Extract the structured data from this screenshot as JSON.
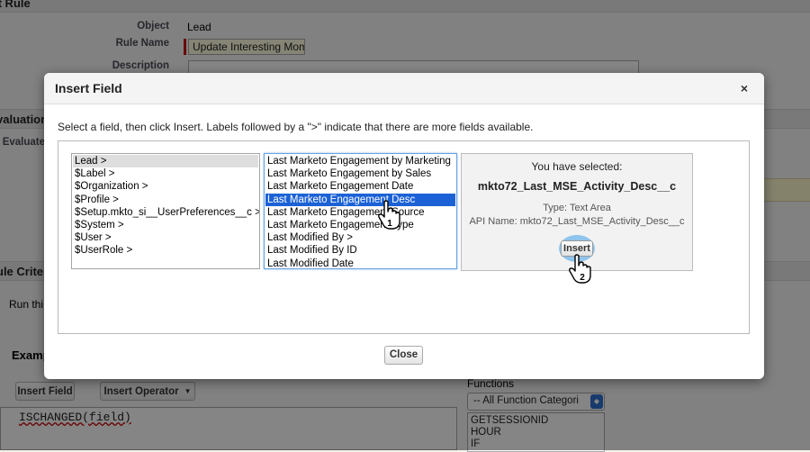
{
  "background": {
    "page_title": "it Rule",
    "fields": {
      "object_label": "Object",
      "object_value": "Lead",
      "rule_name_label": "Rule Name",
      "rule_name_value": "Update Interesting Mom",
      "description_label": "Description"
    },
    "sections": {
      "evaluation": "valuation",
      "evaluate_label": "Evaluate",
      "rule_criteria": "ule Criter",
      "run_this": "Run thi",
      "example": "Examp"
    },
    "buttons": {
      "insert_field": "Insert Field",
      "insert_operator": "Insert Operator"
    },
    "functions": {
      "label": "Functions",
      "select_value": "-- All Function Categori",
      "items": [
        "GETSESSIONID",
        "HOUR",
        "IF"
      ]
    },
    "formula_text": "ISCHANGED(field)"
  },
  "modal": {
    "title": "Insert Field",
    "close_icon": "×",
    "instruction": "Select a field, then click Insert. Labels followed by a \">\" indicate that there are more fields available.",
    "list1": {
      "items": [
        "Lead >",
        "$Label >",
        "$Organization >",
        "$Profile >",
        "$Setup.mkto_si__UserPreferences__c >",
        "$System >",
        "$User >",
        "$UserRole >"
      ],
      "selected_index": 0
    },
    "list2": {
      "items": [
        "Last Marketo Engagement by Marketing",
        "Last Marketo Engagement by Sales",
        "Last Marketo Engagement Date",
        "Last Marketo Engagement Desc",
        "Last Marketo Engagement Source",
        "Last Marketo Engagement Type",
        "Last Modified By >",
        "Last Modified By ID",
        "Last Modified Date"
      ],
      "selected_index": 3
    },
    "selection": {
      "heading": "You have selected:",
      "field_name": "mkto72_Last_MSE_Activity_Desc__c",
      "type_line": "Type: Text Area",
      "api_line": "API Name: mkto72_Last_MSE_Activity_Desc__c"
    },
    "insert_label": "Insert",
    "close_label": "Close",
    "step_markers": [
      "1",
      "2"
    ]
  }
}
